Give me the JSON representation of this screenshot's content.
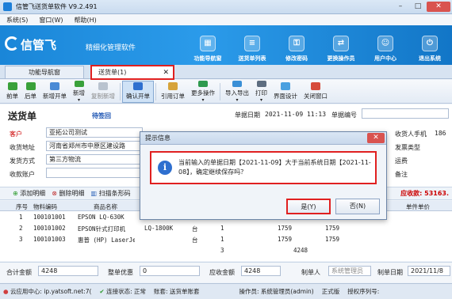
{
  "window": {
    "title": "信管飞送货单软件 V9.2.491"
  },
  "menu": [
    "系统(S)",
    "窗口(W)",
    "帮助(H)"
  ],
  "banner": {
    "logo": "信管飞",
    "slogan": "精细化管理软件",
    "nav": [
      "功能导航窗",
      "送货单列表",
      "修改密码",
      "更换操作员",
      "用户中心",
      "退出系统"
    ]
  },
  "tabs": {
    "home": "功能导航窗",
    "doc": "送货单(1)"
  },
  "toolbar": [
    "前单",
    "后单",
    "新增开单",
    "新增",
    "复制新增",
    "确认开单",
    "引用订单",
    "更多操作",
    "导入导出",
    "打印",
    "界面设计",
    "关闭窗口"
  ],
  "doc": {
    "title": "送货单",
    "status": "待签回",
    "date_label": "单据日期",
    "date_value": "2021-11-09 11:13",
    "no_label": "单据编号",
    "customer_label": "客户",
    "customer_value": "亚拓公司测试",
    "address_label": "收货地址",
    "address_value": "河南省郑州市中原区建设路",
    "shipping_label": "发货方式",
    "shipping_value": "第三方物流",
    "account_label": "收款账户",
    "receiver_phone_label": "收货人手机",
    "receiver_phone_value": "186",
    "invoice_type_label": "发票类型",
    "freight_label": "运费",
    "remark_label": "备注"
  },
  "subbar": {
    "add_row": "添加明细",
    "delete_row": "删除明细",
    "scan": "扫描条形码",
    "due_label": "应收款:",
    "due_value": "53163."
  },
  "grid": {
    "headers": [
      "序号",
      "物料编码",
      "商品名称",
      "",
      "",
      "",
      "",
      "",
      "单件单价"
    ],
    "rows": [
      [
        "1",
        "100101001",
        "EPSON LQ-630K",
        "",
        "",
        "",
        "",
        ""
      ],
      [
        "2",
        "100101002",
        "EPSON针式打印机",
        "LQ-1800K",
        "台",
        "1",
        "1759",
        "1759"
      ],
      [
        "3",
        "100101003",
        "惠普 (HP) LaserJet",
        "",
        "台",
        "1",
        "1759",
        "1759"
      ]
    ],
    "sum_qty": "3",
    "sum_amount": "4248"
  },
  "totals": {
    "total_label": "合计金额",
    "total_value": "4248",
    "discount_label": "整单优惠",
    "discount_value": "0",
    "receivable_label": "应收金额",
    "receivable_value": "4248",
    "maker_label": "制单人",
    "maker_value": "系统管理员",
    "make_date_label": "制单日期",
    "make_date_value": "2021/11/8"
  },
  "status": {
    "cloud": "云应用中心: ip.yatsoft.net:7(",
    "conn": "连接状态: 正常",
    "book": "账套: 送货单账套",
    "user": "操作员: 系统管理员(admin)",
    "edition": "正式版",
    "license": "授权序列号:"
  },
  "dialog": {
    "title": "提示信息",
    "message": "当前输入的单据日期【2021-11-09】大于当前系统日期【2021-11-08】，确定继续保存吗？",
    "yes": "是(Y)",
    "no": "否(N)"
  },
  "colors": {
    "banner": "#1a86d8",
    "highlight_red": "#e02020",
    "due_red": "#c00000"
  }
}
